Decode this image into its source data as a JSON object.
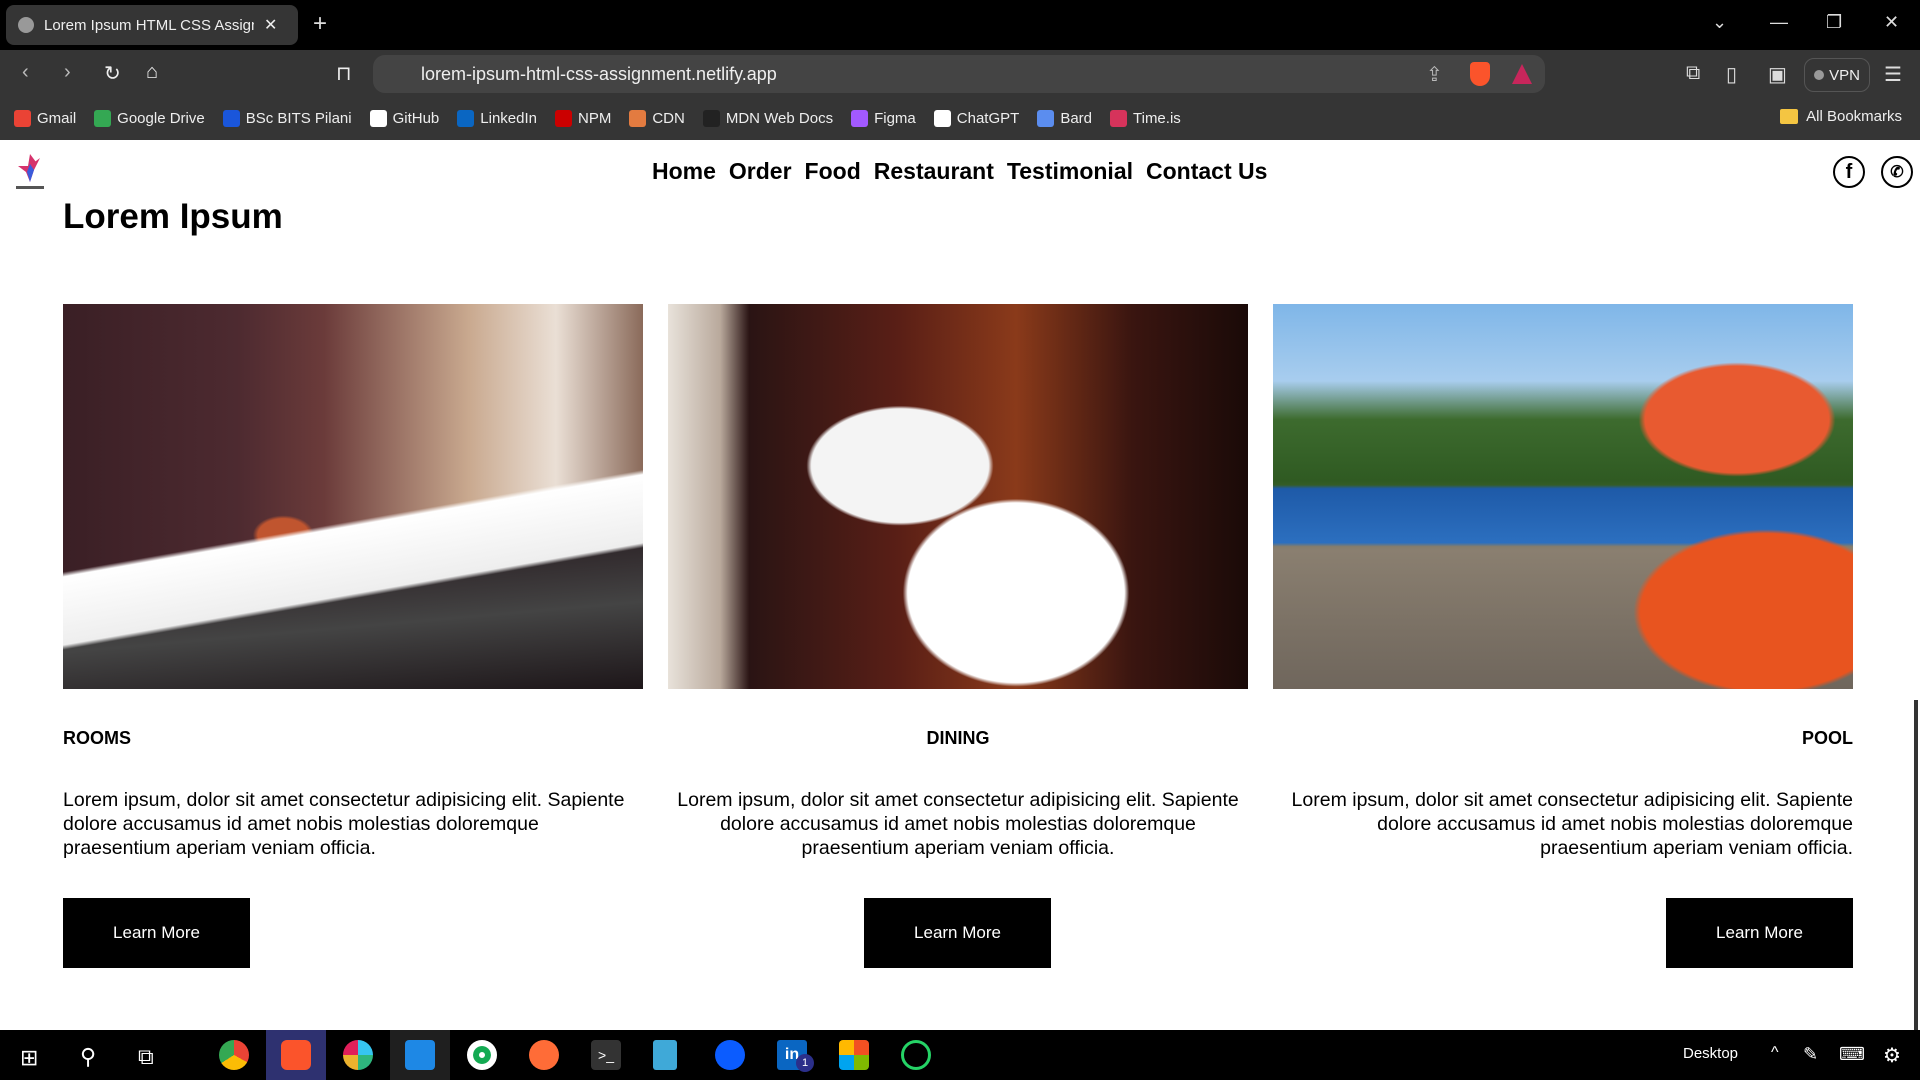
{
  "browser": {
    "tab_title": "Lorem Ipsum HTML CSS Assignment",
    "url": "lorem-ipsum-html-css-assignment.netlify.app",
    "vpn_label": "VPN",
    "bookmarks": [
      "Gmail",
      "Google Drive",
      "BSc BITS Pilani",
      "GitHub",
      "LinkedIn",
      "NPM",
      "CDN",
      "MDN Web Docs",
      "Figma",
      "ChatGPT",
      "Bard",
      "Time.is"
    ],
    "bookmark_colors": [
      "#ea4335",
      "#34a853",
      "#1a56db",
      "#ffffff",
      "#0a66c2",
      "#cb0000",
      "#e37b40",
      "#222222",
      "#a259ff",
      "#ffffff",
      "#5b8def",
      "#d6335b"
    ],
    "all_bookmarks": "All Bookmarks"
  },
  "site": {
    "nav": [
      "Home",
      "Order",
      "Food",
      "Restaurant",
      "Testimonial",
      "Contact Us"
    ],
    "social": [
      "facebook-icon",
      "whatsapp-icon"
    ],
    "title": "Lorem Ipsum",
    "cards": [
      {
        "heading": "ROOMS",
        "text": "Lorem ipsum, dolor sit amet consectetur adipisicing elit. Sapiente dolore accusamus id amet nobis molestias doloremque praesentium aperiam veniam officia.",
        "button": "Learn More",
        "align": "left"
      },
      {
        "heading": "DINING",
        "text": "Lorem ipsum, dolor sit amet consectetur adipisicing elit. Sapiente dolore accusamus id amet nobis molestias doloremque praesentium aperiam veniam officia.",
        "button": "Learn More",
        "align": "center"
      },
      {
        "heading": "POOL",
        "text": "Lorem ipsum, dolor sit amet consectetur adipisicing elit. Sapiente dolore accusamus id amet nobis molestias doloremque praesentium aperiam veniam officia.",
        "button": "Learn More",
        "align": "right"
      }
    ]
  },
  "taskbar": {
    "desktop_label": "Desktop",
    "linkedin_badge": "1"
  }
}
